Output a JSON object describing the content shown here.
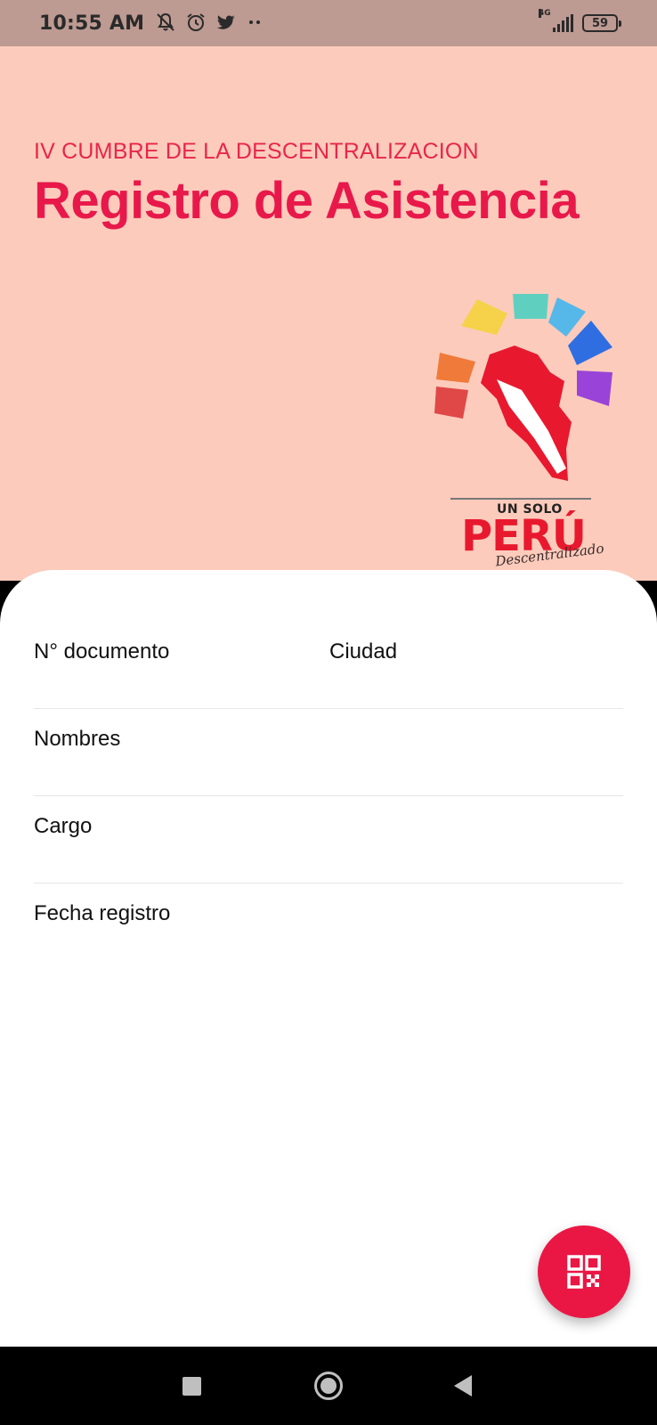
{
  "status_bar": {
    "time": "10:55 AM",
    "left_icons": [
      "notifications-off-icon",
      "alarm-icon",
      "twitter-icon",
      "more-dots-icon"
    ],
    "network": "4G",
    "battery": "59"
  },
  "header": {
    "subtitle": "IV CUMBRE DE LA DESCENTRALIZACION",
    "title": "Registro de Asistencia",
    "logo": {
      "top_text": "UN SOLO",
      "main_text": "PERÚ",
      "script_text": "Descentralizado"
    }
  },
  "form": {
    "document_label": "N° documento",
    "city_label": "Ciudad",
    "names_label": "Nombres",
    "position_label": "Cargo",
    "date_label": "Fecha registro"
  },
  "fab": {
    "icon": "qr-code-icon"
  },
  "colors": {
    "header_bg": "#fccbbc",
    "accent": "#e8194a",
    "status_bar_bg": "#bd9a92"
  }
}
